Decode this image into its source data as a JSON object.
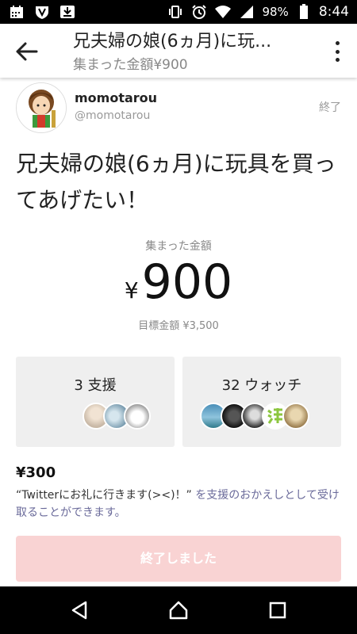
{
  "status_bar": {
    "battery": "98%",
    "time": "8:44"
  },
  "app_bar": {
    "title": "兄夫婦の娘(6ヵ月)に玩...",
    "subtitle": "集まった金額¥900"
  },
  "owner": {
    "username": "momotarou",
    "handle": "@momotarou",
    "status": "終了"
  },
  "project": {
    "title": "兄夫婦の娘(6ヵ月)に玩具を買ってあげたい！",
    "collected_label": "集まった金額",
    "currency": "¥",
    "amount": "900",
    "goal": "目標金額 ¥3,500"
  },
  "stats": {
    "supporters": "3 支援",
    "watchers": "32 ウォッチ"
  },
  "reward": {
    "price": "¥300",
    "text_quote": "“Twitterにお礼に行きます(><)！”",
    "text_rest": " を支援のおかえしとして受け取ることができます。"
  },
  "action": {
    "ended_label": "終了しました"
  },
  "icons": {
    "back": "arrow-left-icon",
    "more": "more-vertical-icon",
    "nav_back": "triangle-back-icon",
    "nav_home": "circle-home-icon",
    "nav_recent": "square-recent-icon"
  },
  "colors": {
    "ended_button": "#f9d3d3",
    "card_background": "#efefef",
    "reward_muted": "#6a6a9a"
  }
}
